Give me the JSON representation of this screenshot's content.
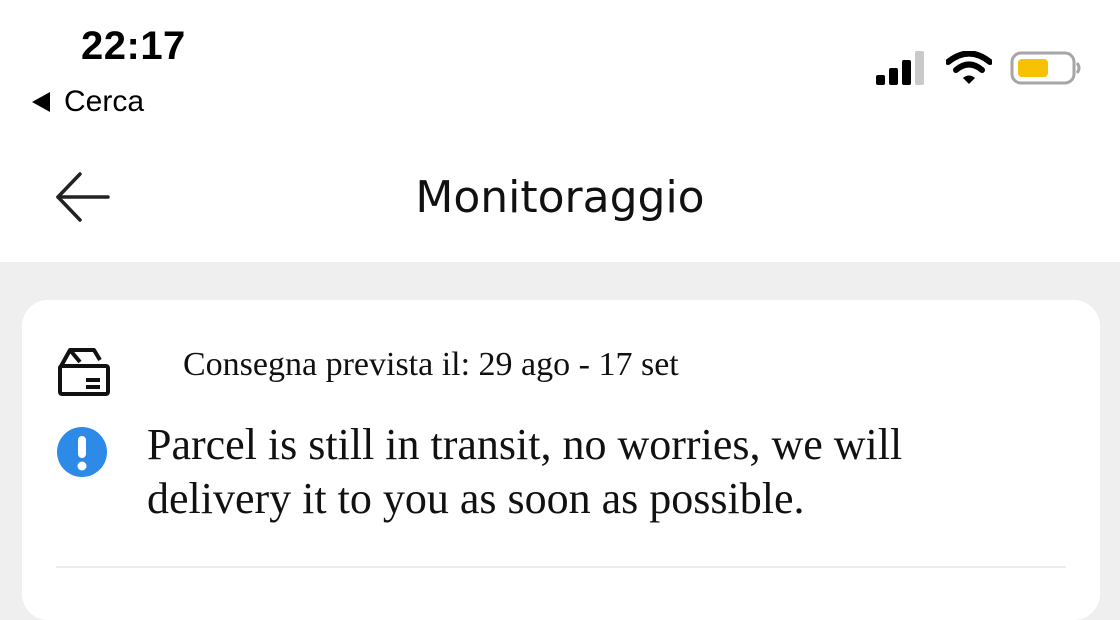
{
  "status_bar": {
    "time": "22:17",
    "back_app_label": "Cerca",
    "icons": [
      "cellular-signal-icon",
      "wifi-icon",
      "battery-icon"
    ],
    "battery_color": "#f6c100"
  },
  "nav": {
    "title": "Monitoraggio",
    "back_icon": "arrow-left-icon"
  },
  "card": {
    "delivery_icon": "package-box-icon",
    "delivery_text": "Consegna prevista il: 29 ago - 17 set",
    "alert_icon": "exclamation-circle-icon",
    "alert_color": "#2d8ae6",
    "alert_message": "Parcel is still in transit, no worries, we will delivery it to you as soon as possible."
  }
}
